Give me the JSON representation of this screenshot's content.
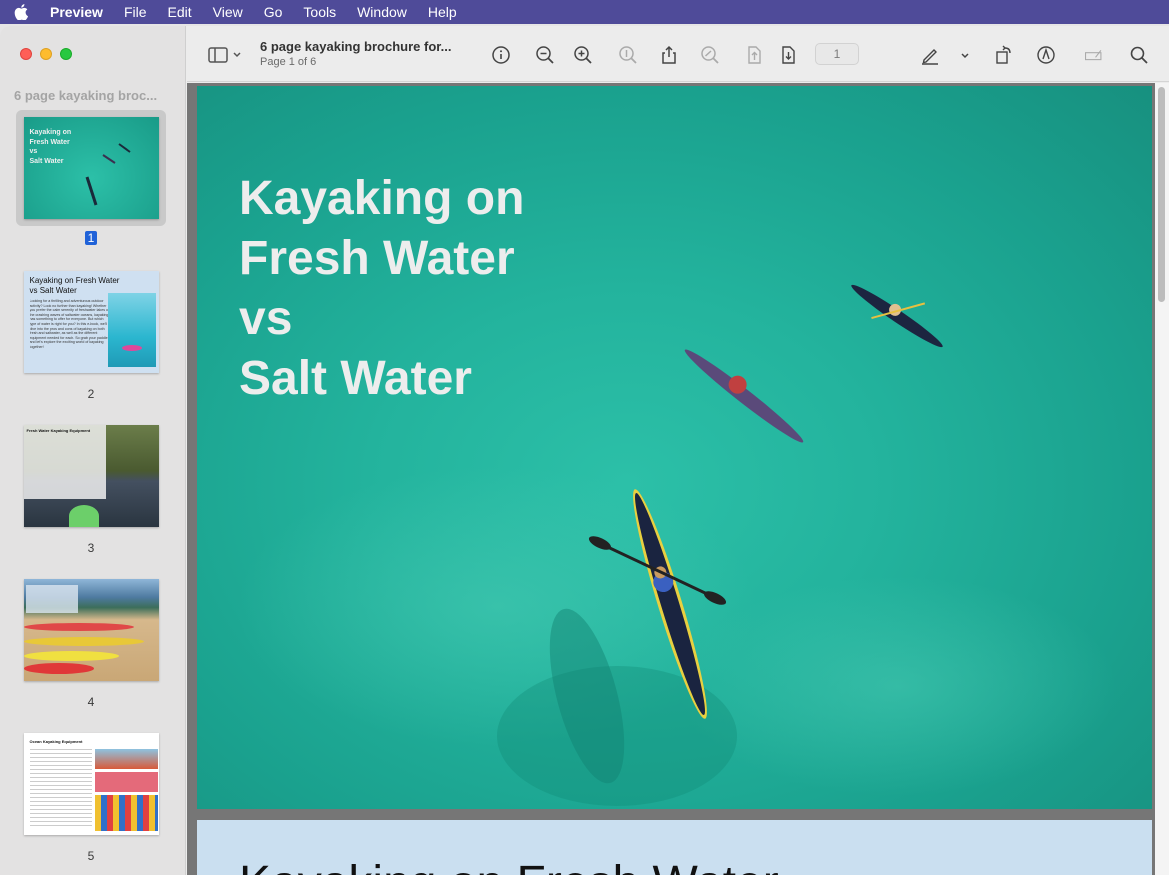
{
  "menubar": {
    "apple_icon": "apple-icon",
    "items": [
      "Preview",
      "File",
      "Edit",
      "View",
      "Go",
      "Tools",
      "Window",
      "Help"
    ]
  },
  "sidebar": {
    "title": "6 page kayaking broc...",
    "thumbnails": [
      {
        "page": "1",
        "title_lines": [
          "Kayaking on",
          "Fresh Water",
          "vs",
          "Salt Water"
        ],
        "selected": true
      },
      {
        "page": "2",
        "title_lines": [
          "Kayaking on Fresh Water",
          "vs Salt Water"
        ],
        "body": "Looking for a thrilling and adventurous outdoor activity? Look no further than kayaking! Whether you prefer the calm serenity of freshwater lakes or the crashing waves of saltwater oceans, kayaking has something to offer for everyone. But which type of water is right for you? In this e-book, we'll dive into the pros and cons of kayaking on both fresh and saltwater, as well as the different equipment needed for each. So grab your paddle and let's explore the exciting world of kayaking together!"
      },
      {
        "page": "3",
        "title_lines": [
          "Fresh Water Kayaking Equipment"
        ]
      },
      {
        "page": "4"
      },
      {
        "page": "5",
        "title_lines": [
          "Ocean Kayaking Equipment"
        ]
      }
    ]
  },
  "toolbar": {
    "doc_title": "6 page kayaking brochure for...",
    "page_status": "Page 1 of 6",
    "page_field": "1",
    "icons": [
      "sidebar-toggle-icon",
      "info-icon",
      "zoom-out-icon",
      "zoom-in-icon",
      "actual-size-icon",
      "share-icon",
      "highlight-icon",
      "rotate-left-icon",
      "rotate-right-icon",
      "markup-icon",
      "rotate-icon",
      "annotate-icon",
      "form-icon",
      "search-icon"
    ]
  },
  "document": {
    "page1_title_lines": [
      "Kayaking on",
      "Fresh Water",
      "vs",
      "Salt Water"
    ],
    "page2_title": "Kayaking on Fresh Water"
  },
  "colors": {
    "menubar": "#4f4b99",
    "water": "#23b39d",
    "selection": "#2062d8"
  }
}
